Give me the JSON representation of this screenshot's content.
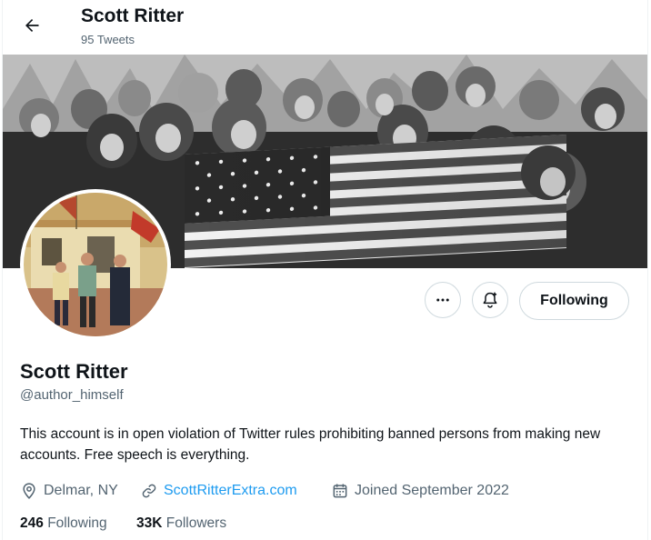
{
  "header": {
    "name": "Scott Ritter",
    "tweet_count": "95 Tweets"
  },
  "icons": {
    "back": "arrow-left-icon",
    "more": "more-dots-icon",
    "notify": "bell-plus-icon",
    "location": "location-pin-icon",
    "link": "link-icon",
    "calendar": "calendar-icon"
  },
  "actions": {
    "following_label": "Following"
  },
  "profile": {
    "name": "Scott Ritter",
    "handle": "@author_himself",
    "bio": "This account is in open violation of Twitter rules prohibiting banned persons from making new accounts. Free speech is everything.",
    "location": "Delmar, NY",
    "website": "ScottRitterExtra.com",
    "joined": "Joined September 2022"
  },
  "stats": {
    "following_count": "246",
    "following_label": "Following",
    "followers_count": "33K",
    "followers_label": "Followers"
  },
  "colors": {
    "accent": "#1d9bf0",
    "text_primary": "#0f1419",
    "text_secondary": "#536471",
    "border": "#cfd9de"
  }
}
